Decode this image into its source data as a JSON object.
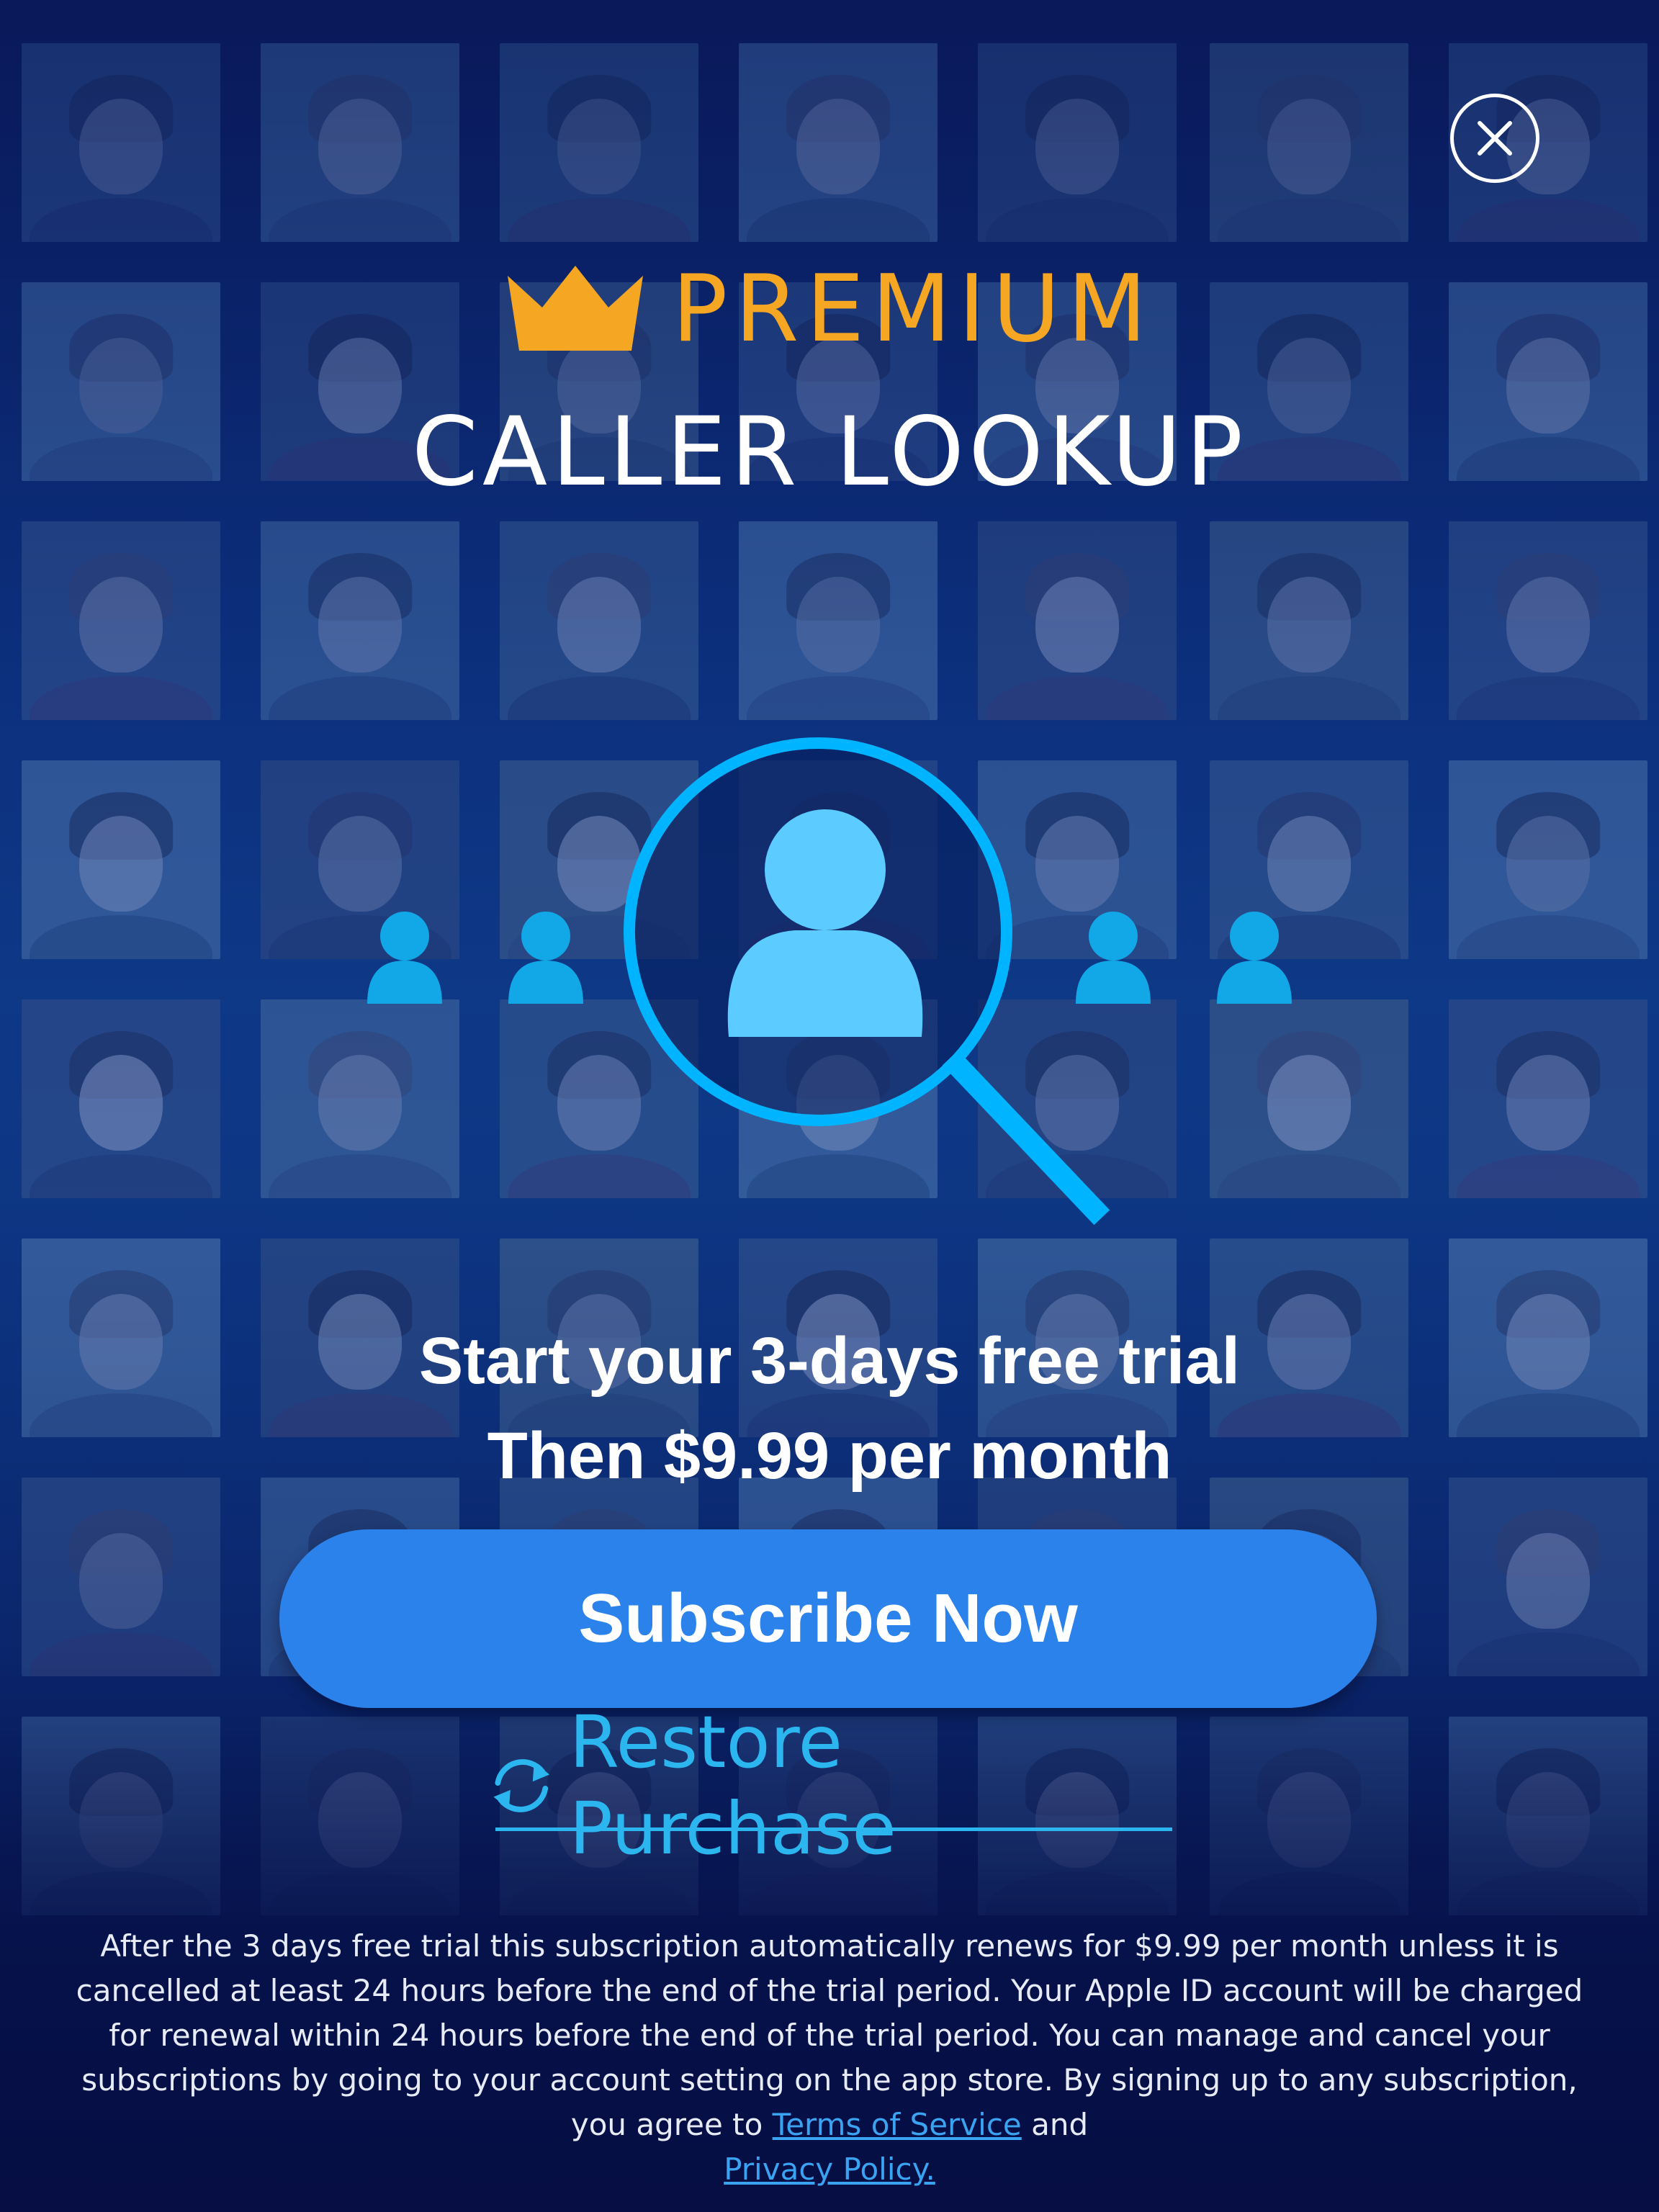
{
  "header": {
    "premium_label": "PREMIUM",
    "title": "CALLER LOOKUP",
    "close_icon": "close-icon",
    "crown_icon": "crown-icon"
  },
  "offer": {
    "trial_line": "Start your 3-days free trial",
    "price_line": "Then $9.99 per month"
  },
  "actions": {
    "subscribe_label": "Subscribe Now",
    "restore_label": "Restore Purchase",
    "restore_icon": "refresh-icon"
  },
  "legal": {
    "text": "After the 3 days free trial this subscription automatically renews for $9.99 per month unless it is cancelled at least 24 hours before the end of the trial period. Your Apple ID account will be charged for renewal within 24 hours before the end of the trial period. You can manage and cancel your subscriptions by going to your account setting on the app store. By signing up to any subscription, you agree to",
    "terms_link": "Terms of Service",
    "and": "and",
    "privacy_link": "Privacy Policy."
  },
  "colors": {
    "accent": "#2b82ea",
    "premium": "#f5a623",
    "link": "#2bb6f0",
    "hero": "#00b4ff"
  }
}
